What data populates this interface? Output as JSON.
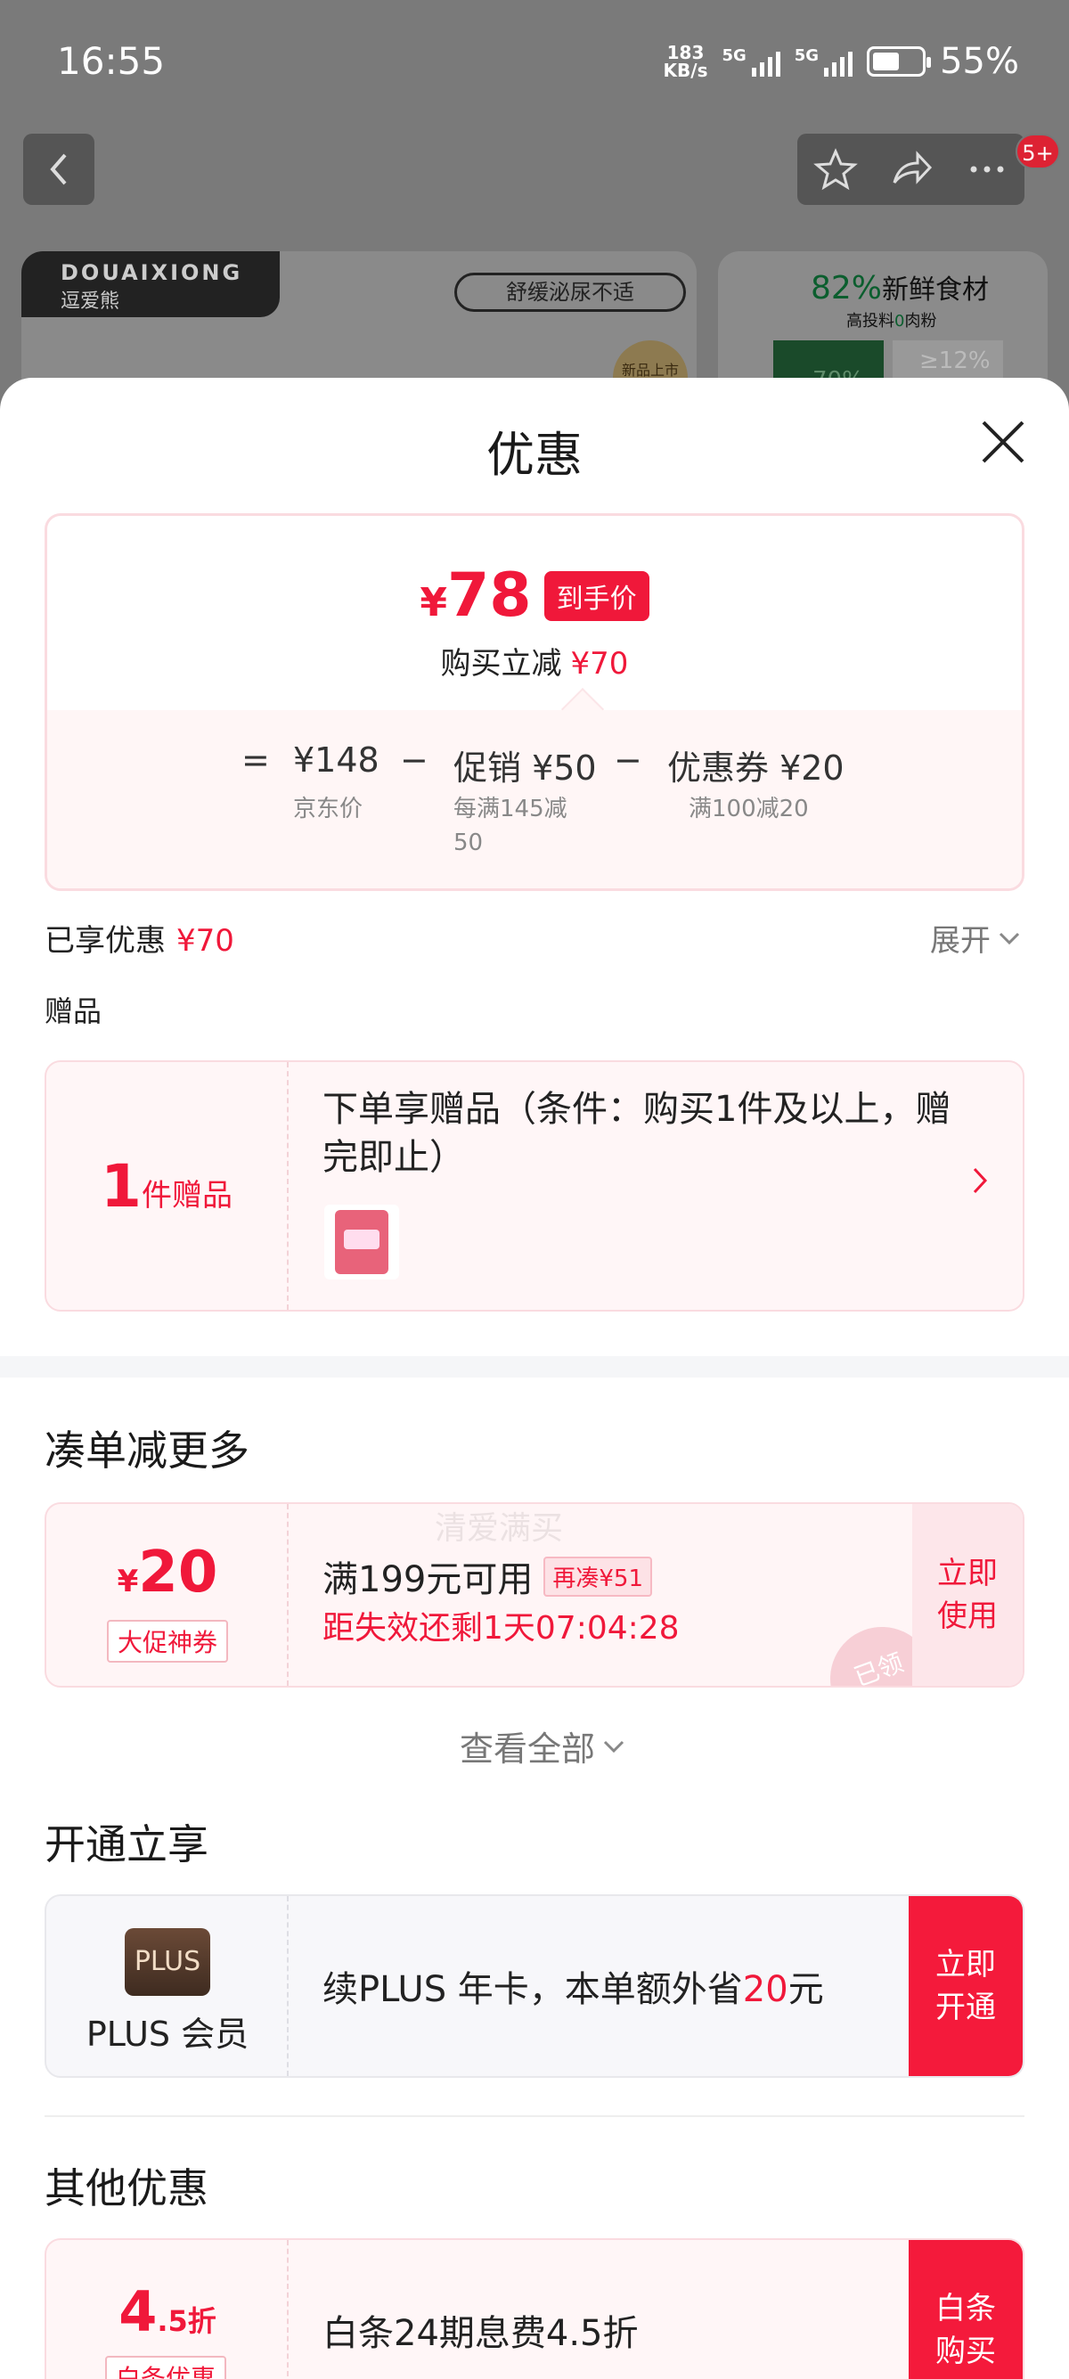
{
  "status_bar": {
    "time": "16:55",
    "net_speed_top": "183",
    "net_speed_bottom": "KB/s",
    "sim1": "5G",
    "sim2": "5G",
    "battery": "55%",
    "battery_level": 0.55
  },
  "background": {
    "brand_en": "DOUAIXIONG",
    "brand_cn": "逗爱熊",
    "banner_pill": "舒缓泌尿不适",
    "medal_text": "新品上市",
    "right_pct": "82%",
    "right_title": "新鲜食材",
    "right_sub_a": "高投料",
    "right_sub_zero": "0",
    "right_sub_b": "肉粉",
    "right_green_text": "70%",
    "right_gray_text": "≥12%",
    "msg_badge": "5+"
  },
  "sheet": {
    "title": "优惠",
    "price_card": {
      "final_symbol": "¥",
      "final_price": "78",
      "final_tag": "到手价",
      "reduce_label": "购买立减",
      "reduce_amount": "¥70",
      "formula": {
        "equals": "=",
        "jd_price": "¥148",
        "minus1": "−",
        "promo": "促销 ¥50",
        "minus2": "−",
        "coupon": "优惠券 ¥20",
        "jd_price_label": "京东价",
        "promo_label_1": "每满145减",
        "promo_label_2": "50",
        "coupon_label": "满100减20"
      }
    },
    "enjoyed_label": "已享优惠",
    "enjoyed_amount": "¥70",
    "expand_label": "展开",
    "gift_section_label": "赠品",
    "gift": {
      "count": "1",
      "unit": "件赠品",
      "text": "下单享赠品（条件：购买1件及以上，赠完即止）"
    },
    "watermark": "清爱满买",
    "more_section_title": "凑单减更多",
    "coupon": {
      "symbol": "¥",
      "amount": "20",
      "type": "大促神券",
      "condition": "满199元可用",
      "extra": "再凑¥51",
      "expire": "距失效还剩1天07:04:28",
      "stamp": "已领",
      "action": "立即使用"
    },
    "view_all": "查看全部",
    "plus_section_title": "开通立享",
    "plus": {
      "logo": "PLUS",
      "name": "PLUS 会员",
      "text_a": "续PLUS 年卡，本单额外省",
      "text_amount": "20",
      "text_b": "元",
      "action": "立即开通"
    },
    "other_section_title": "其他优惠",
    "other": {
      "num": "4",
      "unit": ".5折",
      "tag": "白条优惠",
      "text": "白条24期息费4.5折",
      "action": "白条购买"
    }
  },
  "colors": {
    "accent_red": "#f0183a",
    "button_red": "#f41a3b",
    "card_pink_bg": "#fff6f7"
  }
}
